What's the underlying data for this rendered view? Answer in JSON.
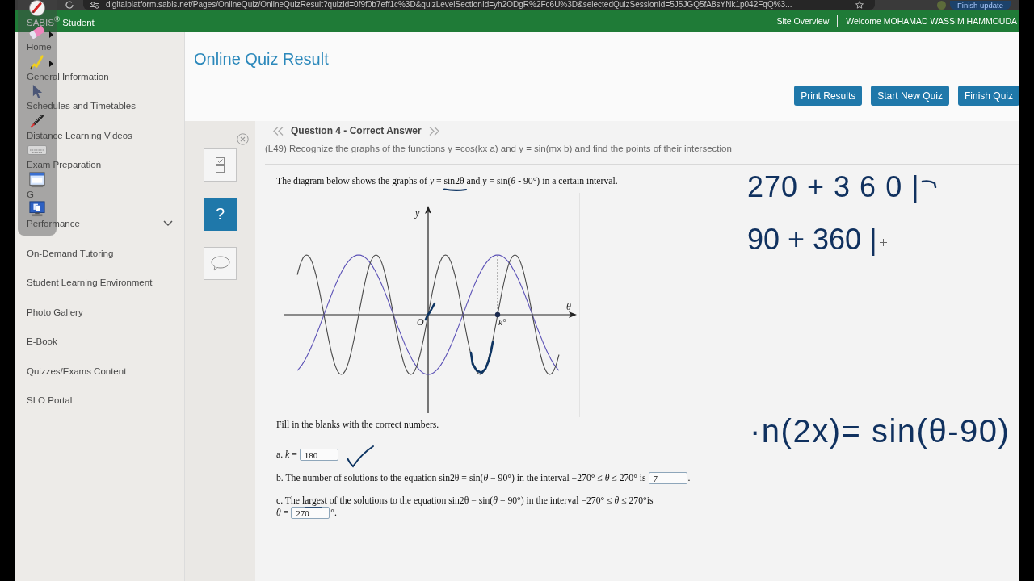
{
  "browser": {
    "address": "digitalplatform.sabis.net/Pages/OnlineQuiz/OnlineQuizResult?quizId=0f9f0b7eff1c%3D&quizLevelSectionId=yh2ODgR%2Fc6U%3D&selectedQuizSessionId=5J5JGQ5fA8sYNk1p042FqQ%3...",
    "update_button": "Finish update"
  },
  "header": {
    "brand": "SABIS$^{®}$ Student",
    "links": [
      "Site Overview",
      "Welcome MOHAMAD WASSIM HAMMOUDA"
    ]
  },
  "annotation_toolbar": {
    "tools": [
      {
        "kind": "pen",
        "submenu": false
      },
      {
        "kind": "eraser",
        "submenu": true
      },
      {
        "kind": "highlighter",
        "submenu": true
      },
      {
        "kind": "pointer",
        "submenu": false
      },
      {
        "kind": "laser",
        "submenu": false
      },
      {
        "kind": "keyboard",
        "submenu": false
      },
      {
        "kind": "whiteboard",
        "submenu": false
      },
      {
        "kind": "screen",
        "submenu": false
      }
    ]
  },
  "sidebar": {
    "items": [
      {
        "label": "Home",
        "kind": "link"
      },
      {
        "label": "General Information",
        "kind": "link"
      },
      {
        "label": "Schedules and Timetables",
        "kind": "link"
      },
      {
        "label": "Distance Learning Videos",
        "kind": "link"
      },
      {
        "label": "Exam Preparation",
        "kind": "link"
      },
      {
        "label": "G",
        "kind": "link"
      },
      {
        "label": "Performance",
        "kind": "group",
        "expanded": false
      },
      {
        "label": "On-Demand Tutoring",
        "kind": "link"
      },
      {
        "label": "Student Learning Environment",
        "kind": "link"
      },
      {
        "label": "Photo Gallery",
        "kind": "link"
      },
      {
        "label": "E-Book",
        "kind": "link"
      },
      {
        "label": "Quizzes/Exams Content",
        "kind": "link"
      },
      {
        "label": "SLO Portal",
        "kind": "link"
      }
    ]
  },
  "page": {
    "title": "Online Quiz Result",
    "buttons": [
      "Print Results",
      "Start New Quiz",
      "Finish Quiz"
    ]
  },
  "quiz_tools": [
    {
      "kind": "checklist",
      "selected": false
    },
    {
      "kind": "help",
      "label": "?",
      "selected": true
    },
    {
      "kind": "comment",
      "selected": false
    }
  ],
  "question": {
    "title": "Question 4 - Correct Answer",
    "objective": "(L49) Recognize the graphs of the functions y =cos(kx a) and y = sin(mx b) and find the points of their intersection",
    "prompt": "The diagram below shows the graphs of *y* = sin2θ and *y* = sin(*θ* - 90°) in a certain interval.",
    "graph": {
      "y_label": "y",
      "x_label": "θ",
      "origin_label": "O",
      "point_label": "k°"
    },
    "instruction": "Fill in the blanks with the correct numbers.",
    "parts": [
      {
        "prefix": "a. *k* =",
        "value": "180"
      },
      {
        "prefix": "b. The number of solutions to the equation sin2θ = sin(*θ* − 90°) in the interval −270° ≤ *θ* ≤ 270° is",
        "value": "7",
        "suffix": "."
      },
      {
        "line": "c. The largest of the solutions to the equation sin2θ = sin(*θ* − 90°) in the interval −270° ≤ *θ* ≤ 270°is",
        "prefix": "*θ* =",
        "value": "270",
        "suffix": "°."
      }
    ]
  },
  "handwriting": [
    "270 + 3 6 0 |",
    "90 + 360 |",
    "·n(2x)= sin(θ-90)"
  ]
}
